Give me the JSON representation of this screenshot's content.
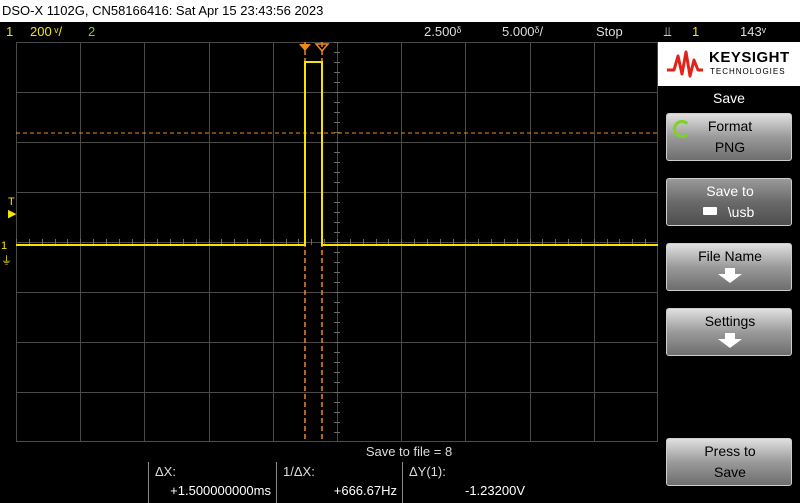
{
  "title": "DSO-X 1102G, CN58166416: Sat Apr 15 23:43:56 2023",
  "status": {
    "ch1_num": "1",
    "ch1_scale": "200 ᵛ/",
    "ch2_num": "2",
    "time_delay": "2.500ᵟ",
    "time_scale": "5.000ᵟ/",
    "run_state": "Stop",
    "trigger_icon": "trigger-edge-icon",
    "trigger_source": "1",
    "trigger_level": "143ᵛ"
  },
  "markers": {
    "trigger_t": "T",
    "ch1_ground": "1"
  },
  "colors": {
    "ch1": "#f5e400",
    "cursor": "#f08a1c",
    "grid": "#4a4a4a",
    "accent": "#7ed321"
  },
  "save_to_file": "Save to file  =  8",
  "measurements": [
    {
      "label": "ΔX:",
      "value": "+1.500000000ms"
    },
    {
      "label": "1/ΔX:",
      "value": "+666.67Hz"
    },
    {
      "label": "ΔY(1):",
      "value": "-1.23200V"
    }
  ],
  "logo": {
    "line1": "KEYSIGHT",
    "line2": "TECHNOLOGIES"
  },
  "menu": {
    "title": "Save",
    "keys": [
      {
        "line1": "Format",
        "line2": "PNG",
        "icon": "rotate-icon"
      },
      {
        "line1": "Save to",
        "line2": "\\usb",
        "icon": "usb-icon"
      },
      {
        "line1": "File Name",
        "line2": "",
        "icon": "arrow-down-icon"
      },
      {
        "line1": "Settings",
        "line2": "",
        "icon": "arrow-down-icon"
      },
      {
        "line1": "Press to",
        "line2": "Save",
        "icon": ""
      }
    ]
  }
}
